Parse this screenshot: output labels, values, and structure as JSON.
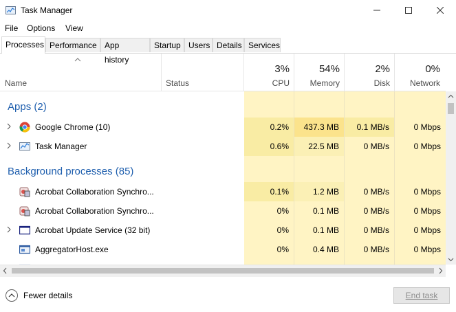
{
  "window": {
    "title": "Task Manager"
  },
  "menu": [
    "File",
    "Options",
    "View"
  ],
  "tabs": [
    "Processes",
    "Performance",
    "App history",
    "Startup",
    "Users",
    "Details",
    "Services"
  ],
  "columns": {
    "name": "Name",
    "status": "Status",
    "cpu": {
      "pct": "3%",
      "label": "CPU"
    },
    "memory": {
      "pct": "54%",
      "label": "Memory"
    },
    "disk": {
      "pct": "2%",
      "label": "Disk"
    },
    "network": {
      "pct": "0%",
      "label": "Network"
    }
  },
  "groups": {
    "apps": "Apps (2)",
    "background": "Background processes (85)"
  },
  "apps": [
    {
      "name": "Google Chrome (10)",
      "cpu": "0.2%",
      "memory": "437.3 MB",
      "disk": "0.1 MB/s",
      "network": "0 Mbps",
      "icon": "chrome-icon"
    },
    {
      "name": "Task Manager",
      "cpu": "0.6%",
      "memory": "22.5 MB",
      "disk": "0 MB/s",
      "network": "0 Mbps",
      "icon": "task-manager-icon"
    }
  ],
  "background": [
    {
      "name": "Acrobat Collaboration Synchro...",
      "cpu": "0.1%",
      "memory": "1.2 MB",
      "disk": "0 MB/s",
      "network": "0 Mbps",
      "icon": "acrobat-sync-icon"
    },
    {
      "name": "Acrobat Collaboration Synchro...",
      "cpu": "0%",
      "memory": "0.1 MB",
      "disk": "0 MB/s",
      "network": "0 Mbps",
      "icon": "acrobat-sync-icon"
    },
    {
      "name": "Acrobat Update Service (32 bit)",
      "cpu": "0%",
      "memory": "0.1 MB",
      "disk": "0 MB/s",
      "network": "0 Mbps",
      "icon": "service-window-icon"
    },
    {
      "name": "AggregatorHost.exe",
      "cpu": "0%",
      "memory": "0.4 MB",
      "disk": "0 MB/s",
      "network": "0 Mbps",
      "icon": "app-window-icon"
    }
  ],
  "footer": {
    "fewer_details": "Fewer details",
    "end_task": "End task"
  },
  "colors": {
    "heat": "#fff4c4",
    "heat_strong": "#f9eca4",
    "heat_mid": "#fbf0b5",
    "group_title": "#1f5fae"
  }
}
